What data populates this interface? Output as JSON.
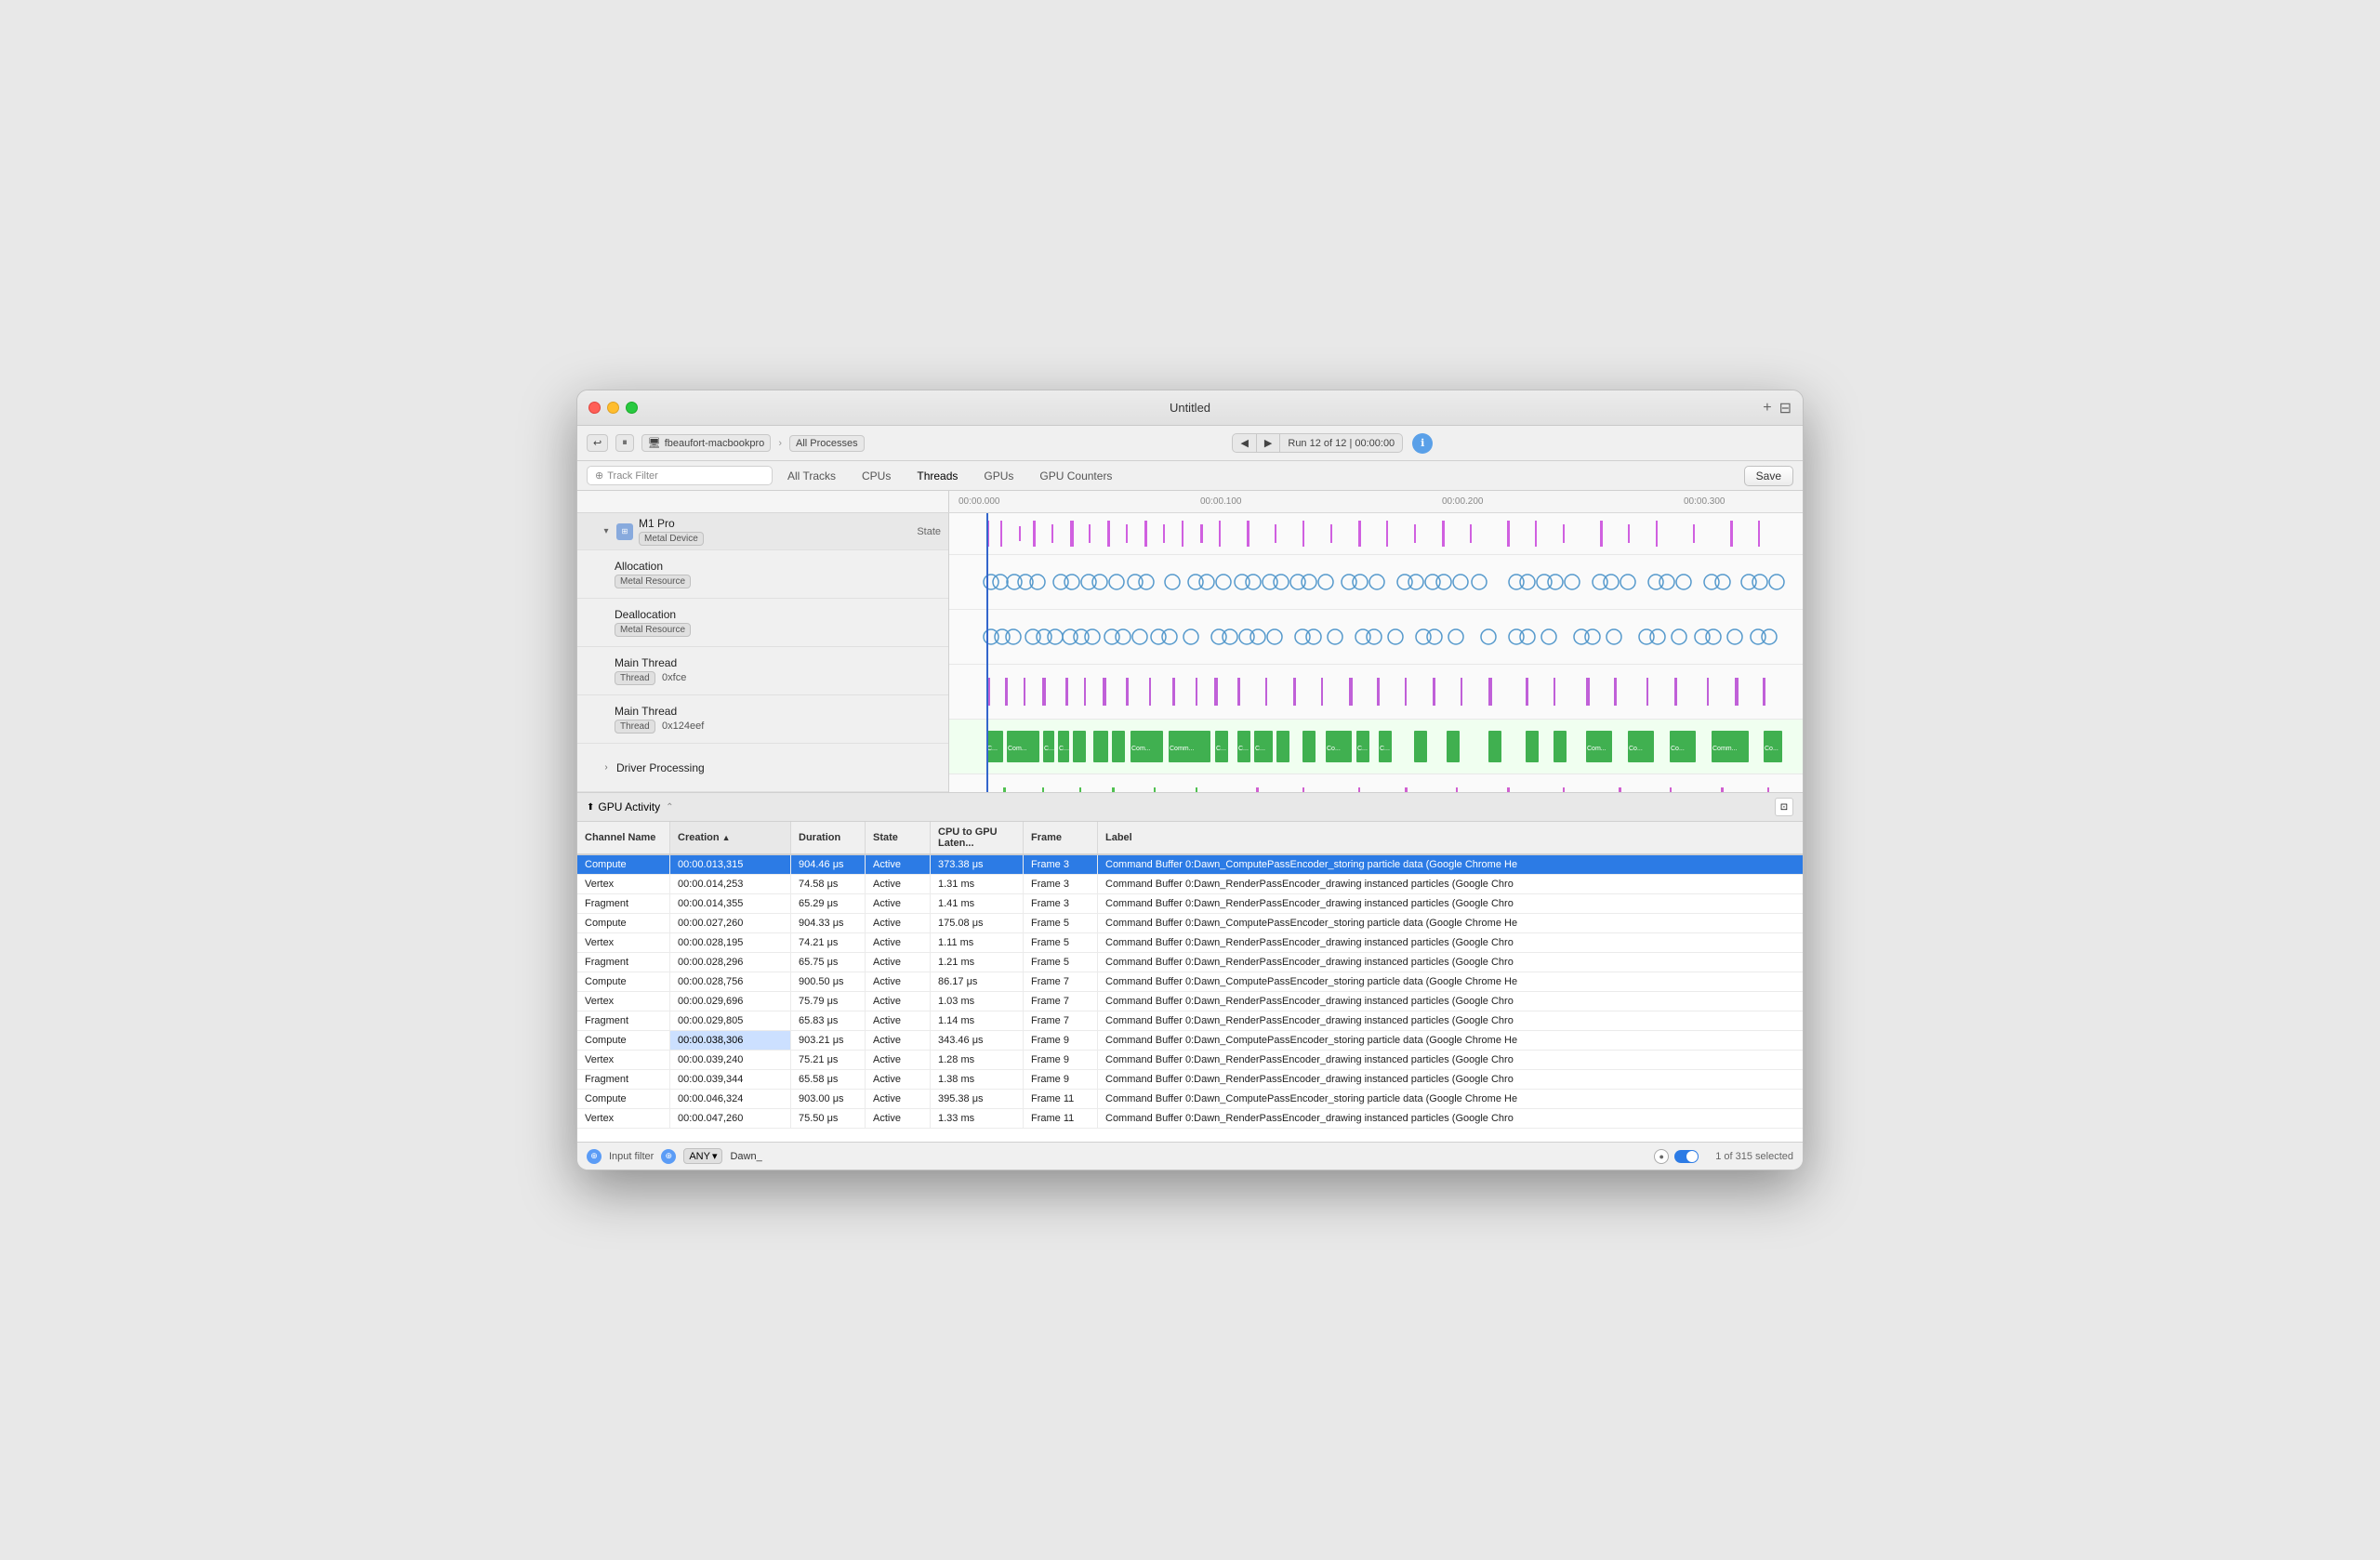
{
  "window": {
    "title": "Untitled"
  },
  "toolbar": {
    "device": "fbeaufort-macbookpro",
    "process": "All Processes",
    "run_label": "Run 12 of 12",
    "run_time": "00:00:00",
    "save_label": "Save"
  },
  "tabs": {
    "items": [
      {
        "id": "all-tracks",
        "label": "All Tracks"
      },
      {
        "id": "cpus",
        "label": "CPUs"
      },
      {
        "id": "threads",
        "label": "Threads"
      },
      {
        "id": "gpus",
        "label": "GPUs"
      },
      {
        "id": "gpu-counters",
        "label": "GPU Counters"
      }
    ]
  },
  "track_filter": {
    "placeholder": "Track Filter"
  },
  "timeline": {
    "marks": [
      "00:00.000",
      "00:00.100",
      "00:00.200",
      "00:00.300"
    ]
  },
  "tracks": [
    {
      "id": "m1-pro",
      "name": "M1 Pro",
      "badge": "Metal Device",
      "state_label": "State",
      "expanded": true,
      "indent": 0
    },
    {
      "id": "allocation",
      "name": "Allocation",
      "badge": "Metal Resource",
      "indent": 1,
      "viz_type": "circles_blue"
    },
    {
      "id": "deallocation",
      "name": "Deallocation",
      "badge": "Metal Resource",
      "indent": 1,
      "viz_type": "circles_blue"
    },
    {
      "id": "main-thread-1",
      "name": "Main Thread",
      "badge": "Thread",
      "badge2": "0xfce",
      "indent": 1,
      "viz_type": "bars_purple"
    },
    {
      "id": "main-thread-2",
      "name": "Main Thread",
      "badge": "Thread",
      "badge2": "0x124eef",
      "indent": 1,
      "viz_type": "bars_green"
    },
    {
      "id": "driver-processing",
      "name": "Driver Processing",
      "indent": 1,
      "expanded": false,
      "viz_type": "bars_mixed"
    }
  ],
  "gpu_activity": {
    "label": "GPU Activity"
  },
  "table": {
    "columns": [
      {
        "id": "channel",
        "label": "Channel Name",
        "width": 100
      },
      {
        "id": "creation",
        "label": "Creation",
        "width": 130,
        "sorted": "asc"
      },
      {
        "id": "duration",
        "label": "Duration",
        "width": 80
      },
      {
        "id": "state",
        "label": "State",
        "width": 70
      },
      {
        "id": "cpu_gpu",
        "label": "CPU to GPU Laten...",
        "width": 100
      },
      {
        "id": "frame",
        "label": "Frame",
        "width": 80
      },
      {
        "id": "label",
        "label": "Label",
        "flex": true
      }
    ],
    "rows": [
      {
        "channel": "Compute",
        "creation": "00:00.013,315",
        "duration": "904.46 μs",
        "state": "Active",
        "cpu_gpu": "373.38 μs",
        "frame": "Frame 3",
        "label": "Command Buffer 0:Dawn_ComputePassEncoder_storing particle data   (Google Chrome He",
        "selected": true
      },
      {
        "channel": "Vertex",
        "creation": "00:00.014,253",
        "duration": "74.58 μs",
        "state": "Active",
        "cpu_gpu": "1.31 ms",
        "frame": "Frame 3",
        "label": "Command Buffer 0:Dawn_RenderPassEncoder_drawing instanced particles   (Google Chro",
        "selected": false
      },
      {
        "channel": "Fragment",
        "creation": "00:00.014,355",
        "duration": "65.29 μs",
        "state": "Active",
        "cpu_gpu": "1.41 ms",
        "frame": "Frame 3",
        "label": "Command Buffer 0:Dawn_RenderPassEncoder_drawing instanced particles   (Google Chro",
        "selected": false
      },
      {
        "channel": "Compute",
        "creation": "00:00.027,260",
        "duration": "904.33 μs",
        "state": "Active",
        "cpu_gpu": "175.08 μs",
        "frame": "Frame 5",
        "label": "Command Buffer 0:Dawn_ComputePassEncoder_storing particle data   (Google Chrome He",
        "selected": false
      },
      {
        "channel": "Vertex",
        "creation": "00:00.028,195",
        "duration": "74.21 μs",
        "state": "Active",
        "cpu_gpu": "1.11 ms",
        "frame": "Frame 5",
        "label": "Command Buffer 0:Dawn_RenderPassEncoder_drawing instanced particles   (Google Chro",
        "selected": false
      },
      {
        "channel": "Fragment",
        "creation": "00:00.028,296",
        "duration": "65.75 μs",
        "state": "Active",
        "cpu_gpu": "1.21 ms",
        "frame": "Frame 5",
        "label": "Command Buffer 0:Dawn_RenderPassEncoder_drawing instanced particles   (Google Chro",
        "selected": false
      },
      {
        "channel": "Compute",
        "creation": "00:00.028,756",
        "duration": "900.50 μs",
        "state": "Active",
        "cpu_gpu": "86.17 μs",
        "frame": "Frame 7",
        "label": "Command Buffer 0:Dawn_ComputePassEncoder_storing particle data   (Google Chrome He",
        "selected": false
      },
      {
        "channel": "Vertex",
        "creation": "00:00.029,696",
        "duration": "75.79 μs",
        "state": "Active",
        "cpu_gpu": "1.03 ms",
        "frame": "Frame 7",
        "label": "Command Buffer 0:Dawn_RenderPassEncoder_drawing instanced particles   (Google Chro",
        "selected": false
      },
      {
        "channel": "Fragment",
        "creation": "00:00.029,805",
        "duration": "65.83 μs",
        "state": "Active",
        "cpu_gpu": "1.14 ms",
        "frame": "Frame 7",
        "label": "Command Buffer 0:Dawn_RenderPassEncoder_drawing instanced particles   (Google Chro",
        "selected": false
      },
      {
        "channel": "Compute",
        "creation": "00:00.038,306",
        "duration": "903.21 μs",
        "state": "Active",
        "cpu_gpu": "343.46 μs",
        "frame": "Frame 9",
        "label": "Command Buffer 0:Dawn_ComputePassEncoder_storing particle data   (Google Chrome He",
        "selected": false,
        "creation_highlight": true
      },
      {
        "channel": "Vertex",
        "creation": "00:00.039,240",
        "duration": "75.21 μs",
        "state": "Active",
        "cpu_gpu": "1.28 ms",
        "frame": "Frame 9",
        "label": "Command Buffer 0:Dawn_RenderPassEncoder_drawing instanced particles   (Google Chro",
        "selected": false
      },
      {
        "channel": "Fragment",
        "creation": "00:00.039,344",
        "duration": "65.58 μs",
        "state": "Active",
        "cpu_gpu": "1.38 ms",
        "frame": "Frame 9",
        "label": "Command Buffer 0:Dawn_RenderPassEncoder_drawing instanced particles   (Google Chro",
        "selected": false
      },
      {
        "channel": "Compute",
        "creation": "00:00.046,324",
        "duration": "903.00 μs",
        "state": "Active",
        "cpu_gpu": "395.38 μs",
        "frame": "Frame 11",
        "label": "Command Buffer 0:Dawn_ComputePassEncoder_storing particle data   (Google Chrome He",
        "selected": false
      },
      {
        "channel": "Vertex",
        "creation": "00:00.047,260",
        "duration": "75.50 μs",
        "state": "Active",
        "cpu_gpu": "1.33 ms",
        "frame": "Frame 11",
        "label": "Command Buffer 0:Dawn_RenderPassEncoder_drawing instanced particles   (Google Chro",
        "selected": false
      }
    ]
  },
  "filter_bar": {
    "input_value": "Dawn_",
    "any_label": "ANY",
    "selected_count": "1 of 315 selected"
  }
}
